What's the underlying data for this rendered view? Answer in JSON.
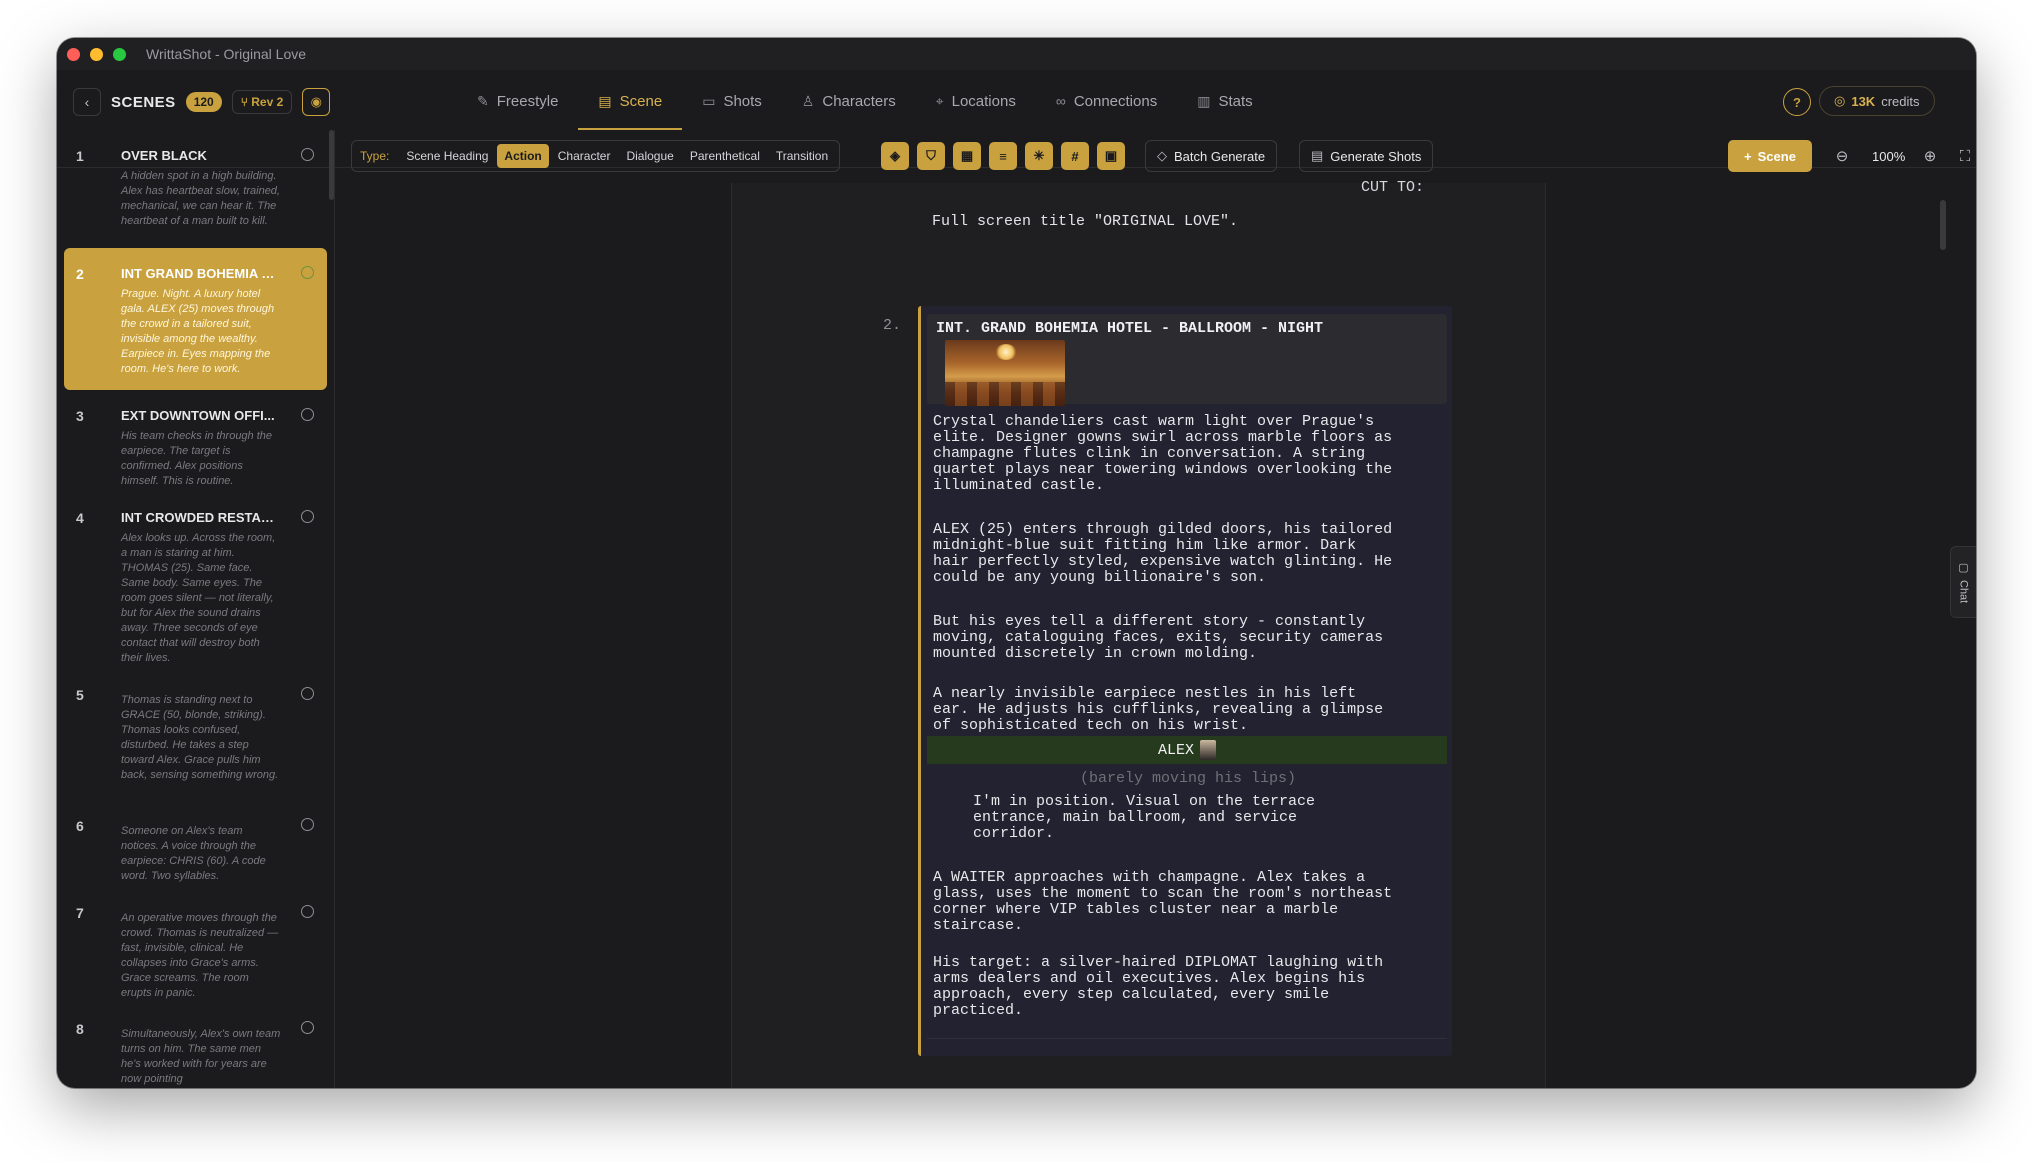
{
  "window": {
    "title": "WrittaShot - Original Love"
  },
  "sidebar": {
    "header_label": "SCENES",
    "scene_count": "120",
    "revision": "Rev 2",
    "scenes": [
      {
        "number": "1",
        "title": "OVER BLACK",
        "desc": "A hidden spot in a high building. Alex has heartbeat slow, trained, mechanical, we can hear it. The heartbeat of a man built to kill."
      },
      {
        "number": "2",
        "title": "INT GRAND BOHEMIA H...",
        "desc": "Prague. Night. A luxury hotel gala. ALEX (25) moves through the crowd in a tailored suit, invisible among the wealthy. Earpiece in. Eyes mapping the room. He's here to work."
      },
      {
        "number": "3",
        "title": "EXT DOWNTOWN OFFI...",
        "desc": "His team checks in through the earpiece. The target is confirmed. Alex positions himself. This is routine."
      },
      {
        "number": "4",
        "title": "INT CROWDED RESTAU...",
        "desc": "Alex looks up. Across the room, a man is staring at him. THOMAS (25). Same face. Same body. Same eyes. The room goes silent — not literally, but for Alex the sound drains away. Three seconds of eye contact that will destroy both their lives."
      },
      {
        "number": "5",
        "title": "",
        "desc": "Thomas is standing next to GRACE (50, blonde, striking). Thomas looks confused, disturbed. He takes a step toward Alex. Grace pulls him back, sensing something wrong."
      },
      {
        "number": "6",
        "title": "",
        "desc": "Someone on Alex's team notices. A voice through the earpiece: CHRIS (60). A code word. Two syllables."
      },
      {
        "number": "7",
        "title": "",
        "desc": "An operative moves through the crowd. Thomas is neutralized — fast, invisible, clinical. He collapses into Grace's arms. Grace screams. The room erupts in panic."
      },
      {
        "number": "8",
        "title": "",
        "desc": "Simultaneously, Alex's own team turns on him. The same men he's worked with for years are now pointing"
      }
    ]
  },
  "nav": {
    "tabs": [
      {
        "label": "Freestyle",
        "icon": "edit-icon"
      },
      {
        "label": "Scene",
        "icon": "document-icon"
      },
      {
        "label": "Shots",
        "icon": "camera-icon"
      },
      {
        "label": "Characters",
        "icon": "person-icon"
      },
      {
        "label": "Locations",
        "icon": "pin-icon"
      },
      {
        "label": "Connections",
        "icon": "link-icon"
      },
      {
        "label": "Stats",
        "icon": "bar-chart-icon"
      }
    ],
    "active_tab": "Scene",
    "help": "?",
    "credits_amount": "13K",
    "credits_word": "credits"
  },
  "toolbar": {
    "type_label": "Type:",
    "types": [
      "Scene Heading",
      "Action",
      "Character",
      "Dialogue",
      "Parenthetical",
      "Transition"
    ],
    "active_type": "Action",
    "batch_generate": "Batch Generate",
    "generate_shots": "Generate Shots",
    "add_scene": "Scene",
    "zoom": "100%"
  },
  "script": {
    "cut_to": "CUT TO:",
    "title_line": "Full screen title \"ORIGINAL LOVE\".",
    "scene_number": "2.",
    "heading": "INT. GRAND BOHEMIA HOTEL - BALLROOM - NIGHT",
    "action_1": "Crystal chandeliers cast warm light over Prague's\nelite. Designer gowns swirl across marble floors as\nchampagne flutes clink in conversation. A string\nquartet plays near towering windows overlooking the\nilluminated castle.",
    "action_2": "ALEX (25) enters through gilded doors, his tailored\nmidnight-blue suit fitting him like armor. Dark\nhair perfectly styled, expensive watch glinting. He\ncould be any young billionaire's son.",
    "action_3": "But his eyes tell a different story - constantly\nmoving, cataloguing faces, exits, security cameras\nmounted discretely in crown molding.",
    "action_4": "A nearly invisible earpiece nestles in his left\near. He adjusts his cufflinks, revealing a glimpse\nof sophisticated tech on his wrist.",
    "character": "ALEX",
    "parenthetical": "(barely moving his lips)",
    "dialogue": "I'm in position. Visual on the terrace\nentrance, main ballroom, and service\ncorridor.",
    "action_5": "A WAITER approaches with champagne. Alex takes a\nglass, uses the moment to scan the room's northeast\ncorner where VIP tables cluster near a marble\nstaircase.",
    "action_6": "His target: a silver-haired DIPLOMAT laughing with\narms dealers and oil executives. Alex begins his\napproach, every step calculated, every smile\npracticed."
  },
  "chat": {
    "label": "Chat"
  },
  "colors": {
    "accent": "#c9a23f",
    "background": "#1b1b1d",
    "character_bg": "#263a1e"
  }
}
